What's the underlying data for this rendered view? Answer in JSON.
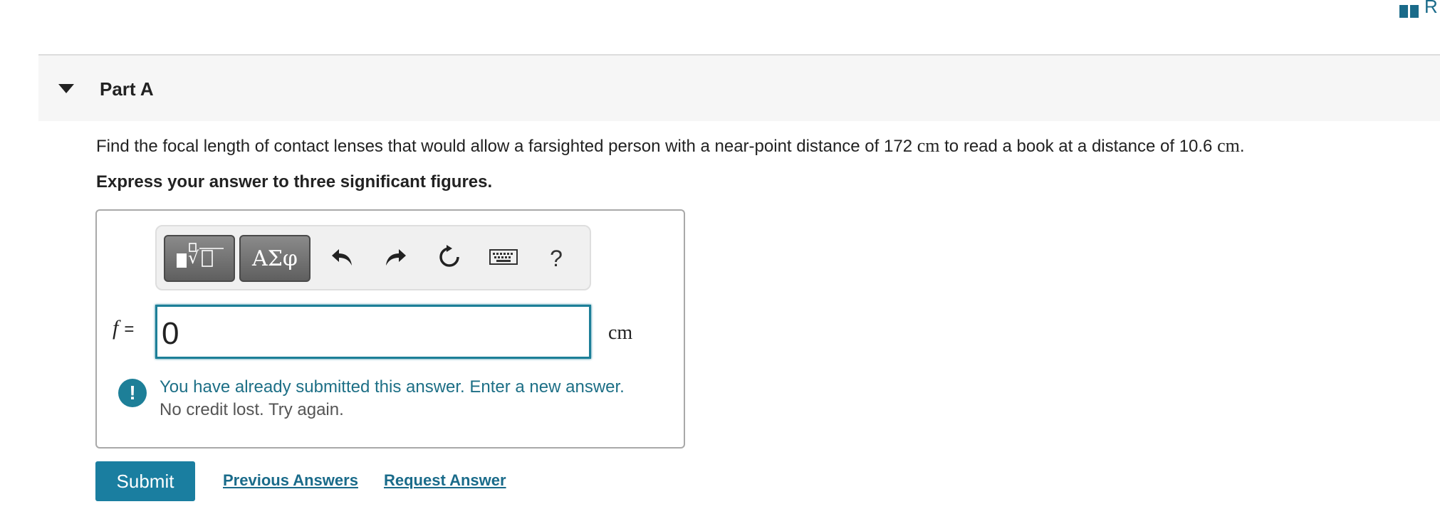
{
  "top_right": {
    "link_text": "R",
    "icon": "book-icon"
  },
  "part": {
    "title": "Part A",
    "toggle_icon": "caret-down-icon"
  },
  "question": {
    "text_before": "Find the focal length of contact lenses that would allow a farsighted person with a near-point distance of 172 ",
    "unit1": "cm",
    "text_middle": " to read a book at a distance of 10.6 ",
    "unit2": "cm",
    "text_after": "."
  },
  "instruction": "Express your answer to three significant figures.",
  "toolbar": {
    "templates_icon": "templates-icon",
    "symbols_label": "ΑΣφ",
    "undo_icon": "undo-icon",
    "redo_icon": "redo-icon",
    "reset_icon": "reset-icon",
    "keyboard_icon": "keyboard-icon",
    "help_label": "?"
  },
  "answer": {
    "variable": "f",
    "equals": "=",
    "value": "0",
    "unit": "cm"
  },
  "alert": {
    "icon_glyph": "!",
    "message": "You have already submitted this answer. Enter a new answer.",
    "sub_message": "No credit lost. Try again."
  },
  "actions": {
    "submit_label": "Submit",
    "previous_answers_label": "Previous Answers",
    "request_answer_label": "Request Answer"
  },
  "colors": {
    "accent": "#1a7ea0",
    "link": "#1a6b8a",
    "input_border": "#1d7f98"
  }
}
